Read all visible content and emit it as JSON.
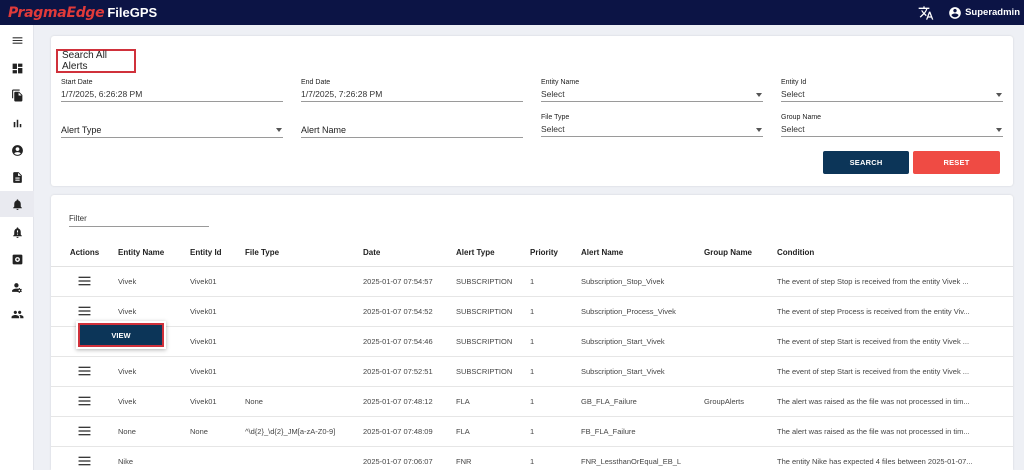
{
  "header": {
    "brand": "PragmaEdge",
    "app_name": "FileGPS",
    "user_name": "Superadmin",
    "brand_color": "#e03a3a",
    "bar_color": "#0c1445"
  },
  "sidebar": {
    "items": [
      {
        "icon": "hamburger-menu-icon"
      },
      {
        "icon": "dashboard-icon"
      },
      {
        "icon": "files-icon"
      },
      {
        "icon": "bar-chart-icon"
      },
      {
        "icon": "user-circle-icon"
      },
      {
        "icon": "document-icon"
      },
      {
        "icon": "bell-icon",
        "active": true
      },
      {
        "icon": "bell-alert-icon"
      },
      {
        "icon": "settings-box-icon"
      },
      {
        "icon": "user-settings-icon"
      },
      {
        "icon": "group-icon"
      }
    ]
  },
  "search": {
    "title": "Search All Alerts",
    "start_date_label": "Start Date",
    "start_date_value": "1/7/2025, 6:26:28 PM",
    "end_date_label": "End Date",
    "end_date_value": "1/7/2025, 7:26:28 PM",
    "entity_name_label": "Entity Name",
    "entity_name_value": "Select",
    "entity_id_label": "Entity Id",
    "entity_id_value": "Select",
    "alert_type_label": "Alert Type",
    "alert_name_label": "Alert Name",
    "file_type_label": "File Type",
    "file_type_value": "Select",
    "group_name_label": "Group Name",
    "group_name_value": "Select",
    "search_button": "SEARCH",
    "reset_button": "RESET"
  },
  "table": {
    "filter_placeholder": "Filter",
    "columns": [
      "Actions",
      "Entity Name",
      "Entity Id",
      "File Type",
      "Date",
      "Alert Type",
      "Priority",
      "Alert Name",
      "Group Name",
      "Condition"
    ],
    "rows": [
      {
        "entity_name": "Vivek",
        "entity_id": "Vivek01",
        "file_type": "",
        "date": "2025-01-07 07:54:57",
        "alert_type": "SUBSCRIPTION",
        "priority": "1",
        "alert_name": "Subscription_Stop_Vivek",
        "group_name": "",
        "condition": "The event of step Stop is received from the entity Vivek ..."
      },
      {
        "entity_name": "Vivek",
        "entity_id": "Vivek01",
        "file_type": "",
        "date": "2025-01-07 07:54:52",
        "alert_type": "SUBSCRIPTION",
        "priority": "1",
        "alert_name": "Subscription_Process_Vivek",
        "group_name": "",
        "condition": "The event of step Process is received from the entity Viv..."
      },
      {
        "entity_name": "",
        "entity_id": "Vivek01",
        "file_type": "",
        "date": "2025-01-07 07:54:46",
        "alert_type": "SUBSCRIPTION",
        "priority": "1",
        "alert_name": "Subscription_Start_Vivek",
        "group_name": "",
        "condition": "The event of step Start is received from the entity Vivek ..."
      },
      {
        "entity_name": "Vivek",
        "entity_id": "Vivek01",
        "file_type": "",
        "date": "2025-01-07 07:52:51",
        "alert_type": "SUBSCRIPTION",
        "priority": "1",
        "alert_name": "Subscription_Start_Vivek",
        "group_name": "",
        "condition": "The event of step Start is received from the entity Vivek ..."
      },
      {
        "entity_name": "Vivek",
        "entity_id": "Vivek01",
        "file_type": "None",
        "date": "2025-01-07 07:48:12",
        "alert_type": "FLA",
        "priority": "1",
        "alert_name": "GB_FLA_Failure",
        "group_name": "GroupAlerts",
        "condition": "The alert was raised as the file was not processed in tim..."
      },
      {
        "entity_name": "None",
        "entity_id": "None",
        "file_type": "^\\d{2}_\\d{2}_JM[a-zA-Z0-9]",
        "date": "2025-01-07 07:48:09",
        "alert_type": "FLA",
        "priority": "1",
        "alert_name": "FB_FLA_Failure",
        "group_name": "",
        "condition": "The alert was raised as the file was not processed in tim..."
      },
      {
        "entity_name": "Nike",
        "entity_id": "",
        "file_type": "",
        "date": "2025-01-07 07:06:07",
        "alert_type": "FNR",
        "priority": "1",
        "alert_name": "FNR_LessthanOrEqual_EB_L",
        "group_name": "",
        "condition": "The entity Nike has expected 4 files between 2025-01-07..."
      }
    ]
  },
  "popup": {
    "view_label": "VIEW"
  }
}
